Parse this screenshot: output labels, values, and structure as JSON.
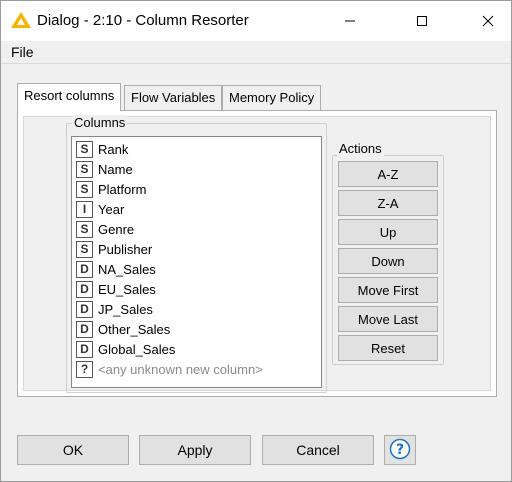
{
  "window": {
    "title": "Dialog - 2:10 - Column Resorter"
  },
  "menu": {
    "file_label": "File"
  },
  "tabs": [
    {
      "label": "Resort columns",
      "active": true
    },
    {
      "label": "Flow Variables",
      "active": false
    },
    {
      "label": "Memory Policy",
      "active": false
    }
  ],
  "columns_group": {
    "title": "Columns",
    "items": [
      {
        "type": "S",
        "name": "Rank"
      },
      {
        "type": "S",
        "name": "Name"
      },
      {
        "type": "S",
        "name": "Platform"
      },
      {
        "type": "I",
        "name": "Year"
      },
      {
        "type": "S",
        "name": "Genre"
      },
      {
        "type": "S",
        "name": "Publisher"
      },
      {
        "type": "D",
        "name": "NA_Sales"
      },
      {
        "type": "D",
        "name": "EU_Sales"
      },
      {
        "type": "D",
        "name": "JP_Sales"
      },
      {
        "type": "D",
        "name": "Other_Sales"
      },
      {
        "type": "D",
        "name": "Global_Sales"
      },
      {
        "type": "?",
        "name": "<any unknown new column>"
      }
    ]
  },
  "actions_group": {
    "title": "Actions",
    "buttons": [
      "A-Z",
      "Z-A",
      "Up",
      "Down",
      "Move First",
      "Move Last",
      "Reset"
    ]
  },
  "footer": {
    "ok_label": "OK",
    "apply_label": "Apply",
    "cancel_label": "Cancel"
  },
  "colors": {
    "accent_help": "#1a73c9",
    "app_icon": "#f5b400"
  }
}
